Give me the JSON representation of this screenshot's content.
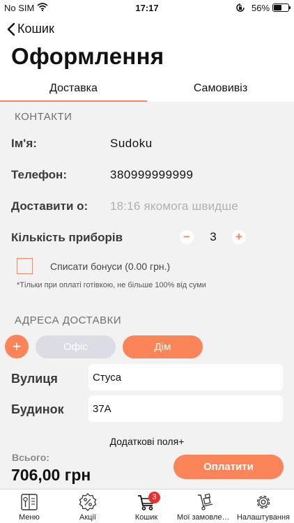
{
  "status_bar": {
    "carrier": "No SIM",
    "time": "17:17",
    "battery_pct": "56%",
    "battery_level": 0.56
  },
  "header": {
    "back_label": "Кошик",
    "title": "Оформлення"
  },
  "tabs": {
    "delivery": "Доставка",
    "pickup": "Самовивіз",
    "active": "delivery"
  },
  "contacts": {
    "section_title": "КОНТАКТИ",
    "name_label": "Ім'я:",
    "name_value": "Sudoku",
    "phone_label": "Телефон:",
    "phone_value": "380999999999",
    "deliver_at_label": "Доставити о:",
    "deliver_at_placeholder": "18:16 якомога швидше",
    "cutlery_label": "Кількість приборів",
    "cutlery_count": "3",
    "bonus_label": "Списати бонуси  (0.00 грн.)",
    "bonus_checked": false,
    "bonus_note": "*Тільки при оплаті готівкою, не більше 100% від суми"
  },
  "address": {
    "section_title": "АДРЕСА ДОСТАВКИ",
    "add_symbol": "+",
    "office_label": "Офіс",
    "home_label": "Дім",
    "selected": "home",
    "street_label": "Вулиця",
    "street_value": "Стуса",
    "house_label": "Будинок",
    "house_value": "37А",
    "extra_fields": "Додаткові поля+"
  },
  "footer": {
    "total_label": "Всього:",
    "total_value": "706,00 грн",
    "pay_label": "Оплатити"
  },
  "tabbar": {
    "items": [
      {
        "label": "Меню",
        "icon": "menu-book-icon"
      },
      {
        "label": "Акції",
        "icon": "discount-badge-icon"
      },
      {
        "label": "Кошик",
        "icon": "cart-icon",
        "badge": "3"
      },
      {
        "label": "Мої замовлення",
        "icon": "delivery-trolley-icon"
      },
      {
        "label": "Налаштування",
        "icon": "gear-icon"
      }
    ]
  },
  "colors": {
    "accent": "#fb8458",
    "background": "#f2f2f2",
    "pill_inactive": "#dcdde4",
    "badge": "#e8312c"
  }
}
